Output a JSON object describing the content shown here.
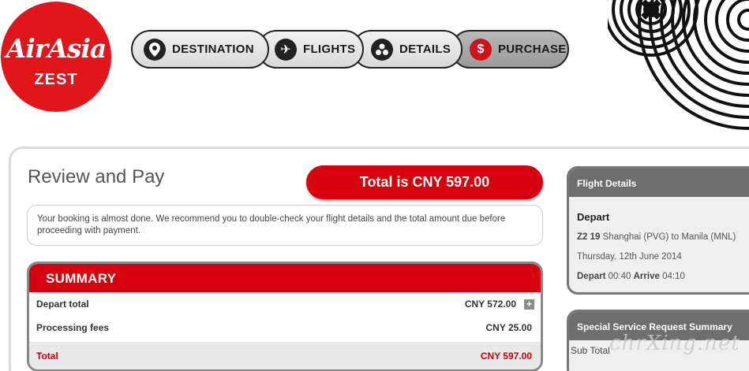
{
  "logo": {
    "line1": "AirAsia",
    "line2": "ZEST"
  },
  "steps": [
    {
      "label": "DESTINATION",
      "icon": "map-pin-icon",
      "glyph": "⬤"
    },
    {
      "label": "FLIGHTS",
      "icon": "airplane-icon",
      "glyph": "✈"
    },
    {
      "label": "DETAILS",
      "icon": "people-icon",
      "glyph": "⚇"
    },
    {
      "label": "PURCHASE",
      "icon": "dollar-icon",
      "glyph": "$"
    }
  ],
  "page": {
    "title": "Review and Pay",
    "total_label": "Total is CNY 597.00",
    "notice": "Your booking is almost done. We recommend you to double-check your flight details and the total amount due before proceeding with payment."
  },
  "summary": {
    "heading": "SUMMARY",
    "rows": [
      {
        "label": "Depart total",
        "amount": "CNY 572.00"
      },
      {
        "label": "Processing fees",
        "amount": "CNY 25.00"
      }
    ],
    "total": {
      "label": "Total",
      "amount": "CNY 597.00"
    },
    "expand_glyph": "+"
  },
  "flight_details": {
    "heading": "Flight Details",
    "direction": "Depart",
    "flight_no": "Z2 19",
    "route": "Shanghai (PVG) to Manila (MNL)",
    "date": "Thursday, 12th June 2014",
    "depart_label": "Depart",
    "depart_time": "00:40",
    "arrive_label": "Arrive",
    "arrive_time": "04:10"
  },
  "ssr_summary": {
    "heading": "Special Service Request Summary",
    "subtotal_label": "Sub Total"
  },
  "watermark": "chrXing.net",
  "colors": {
    "brand_red": "#d6000f",
    "logo_red": "#e2151b",
    "dark_grey": "#6e6e6e"
  }
}
